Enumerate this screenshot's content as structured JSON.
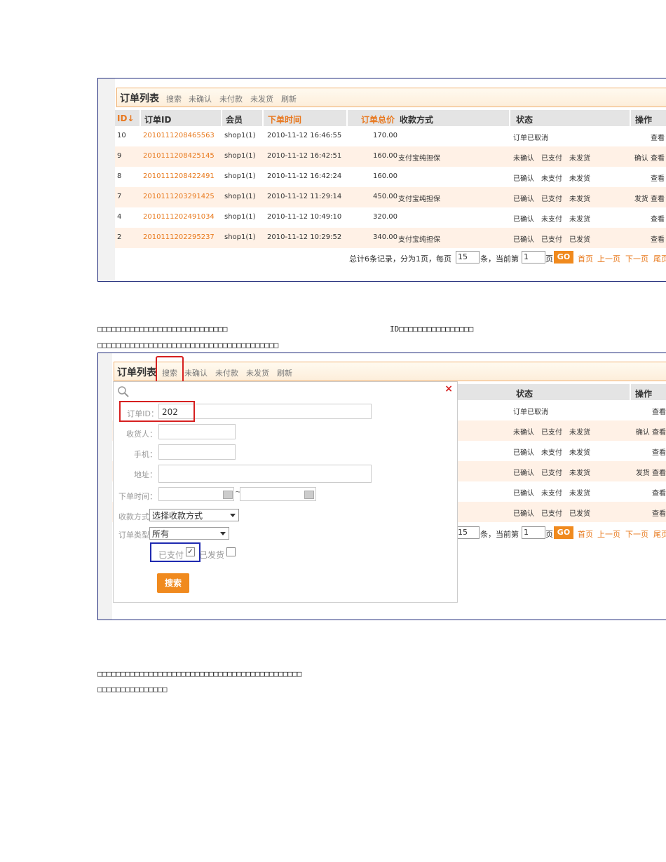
{
  "shot1": {
    "toolbar": {
      "title": "订单列表",
      "links": [
        "搜索",
        "未确认",
        "未付款",
        "未发货",
        "刷新"
      ]
    },
    "headers": [
      "ID↓",
      "订单ID",
      "会员",
      "下单时间",
      "订单总价",
      "收款方式",
      "状态",
      "操作"
    ],
    "rows": [
      {
        "id": "10",
        "order_id": "2010111208465563",
        "member": "shop1(1)",
        "time": "2010-11-12 16:46:55",
        "price": "170.00",
        "pay": "",
        "status": [
          {
            "t": "订单已取消",
            "c": "gr"
          }
        ],
        "ops": "查看"
      },
      {
        "id": "9",
        "order_id": "2010111208425145",
        "member": "shop1(1)",
        "time": "2010-11-12 16:42:51",
        "price": "160.00",
        "pay": "支付宝纯担保",
        "status": [
          {
            "t": "未确认",
            "c": "r"
          },
          {
            "t": "已支付",
            "c": "g"
          },
          {
            "t": "未发货",
            "c": "r"
          }
        ],
        "ops": "确认 查看"
      },
      {
        "id": "8",
        "order_id": "2010111208422491",
        "member": "shop1(1)",
        "time": "2010-11-12 16:42:24",
        "price": "160.00",
        "pay": "",
        "status": [
          {
            "t": "已确认",
            "c": "g"
          },
          {
            "t": "未支付",
            "c": "r"
          },
          {
            "t": "未发货",
            "c": "r"
          }
        ],
        "ops": "查看"
      },
      {
        "id": "7",
        "order_id": "2010111203291425",
        "member": "shop1(1)",
        "time": "2010-11-12 11:29:14",
        "price": "450.00",
        "pay": "支付宝纯担保",
        "status": [
          {
            "t": "已确认",
            "c": "g"
          },
          {
            "t": "已支付",
            "c": "g"
          },
          {
            "t": "未发货",
            "c": "r"
          }
        ],
        "ops": "发货 查看"
      },
      {
        "id": "4",
        "order_id": "2010111202491034",
        "member": "shop1(1)",
        "time": "2010-11-12 10:49:10",
        "price": "320.00",
        "pay": "",
        "status": [
          {
            "t": "已确认",
            "c": "g"
          },
          {
            "t": "未支付",
            "c": "r"
          },
          {
            "t": "未发货",
            "c": "r"
          }
        ],
        "ops": "查看"
      },
      {
        "id": "2",
        "order_id": "2010111202295237",
        "member": "shop1(1)",
        "time": "2010-11-12 10:29:52",
        "price": "340.00",
        "pay": "支付宝纯担保",
        "status": [
          {
            "t": "已确认",
            "c": "g"
          },
          {
            "t": "已支付",
            "c": "g"
          },
          {
            "t": "已发货",
            "c": "g"
          }
        ],
        "ops": "查看"
      }
    ],
    "pager": {
      "summary": "总计6条记录，分为1页，每页",
      "per_page": "15",
      "per_unit": "条，当前第",
      "current": "1",
      "page_unit": "页",
      "go": "GO",
      "links": [
        "首页",
        "上一页",
        "下一页",
        "尾页"
      ]
    }
  },
  "caption1": {
    "line1a": "□□□□□□□□□□□□□□□□□□□□□□□□□□□□",
    "line1b": "ID□□□□□□□□□□□□□□□□",
    "line2": "□□□□□□□□□□□□□□□□□□□□□□□□□□□□□□□□□□□□□□□"
  },
  "shot2": {
    "toolbar": {
      "title": "订单列表",
      "links": [
        "搜索",
        "未确认",
        "未付款",
        "未发货",
        "刷新"
      ]
    },
    "header_status": "状态",
    "header_ops": "操作",
    "status_rows": [
      {
        "status": [
          {
            "t": "订单已取消",
            "c": "gr"
          }
        ],
        "ops": "查看"
      },
      {
        "status": [
          {
            "t": "未确认",
            "c": "r"
          },
          {
            "t": "已支付",
            "c": "g"
          },
          {
            "t": "未发货",
            "c": "r"
          }
        ],
        "ops": "确认 查看"
      },
      {
        "status": [
          {
            "t": "已确认",
            "c": "g"
          },
          {
            "t": "未支付",
            "c": "r"
          },
          {
            "t": "未发货",
            "c": "r"
          }
        ],
        "ops": "查看"
      },
      {
        "status": [
          {
            "t": "已确认",
            "c": "g"
          },
          {
            "t": "已支付",
            "c": "g"
          },
          {
            "t": "未发货",
            "c": "r"
          }
        ],
        "ops": "发货 查看"
      },
      {
        "status": [
          {
            "t": "已确认",
            "c": "g"
          },
          {
            "t": "未支付",
            "c": "r"
          },
          {
            "t": "未发货",
            "c": "r"
          }
        ],
        "ops": "查看"
      },
      {
        "status": [
          {
            "t": "已确认",
            "c": "g"
          },
          {
            "t": "已支付",
            "c": "g"
          },
          {
            "t": "已发货",
            "c": "g"
          }
        ],
        "ops": "查看"
      }
    ],
    "pager": {
      "per_page": "15",
      "per_unit": "条，当前第",
      "current": "1",
      "page_unit": "页",
      "go": "GO",
      "links": [
        "首页",
        "上一页",
        "下一页",
        "尾页"
      ]
    },
    "search": {
      "order_id_label": "订单ID：",
      "order_id_value": "202",
      "consignee_label": "收货人：",
      "mobile_label": "手机：",
      "address_label": "地址：",
      "time_label": "下单时间：",
      "time_sep": "~",
      "pay_label": "收款方式：",
      "pay_value": "选择收款方式",
      "type_label": "订单类型：",
      "type_value": "所有",
      "paid_label": "已支付",
      "paid_checked": "✓",
      "shipped_label": "已发货",
      "submit": "搜索"
    }
  },
  "caption2": {
    "line1": "□□□□□□□□□□□□□□□□□□□□□□□□□□□□□□□□□□□□□□□□□□□□",
    "line2": "□□□□□□□□□□□□□□□"
  }
}
